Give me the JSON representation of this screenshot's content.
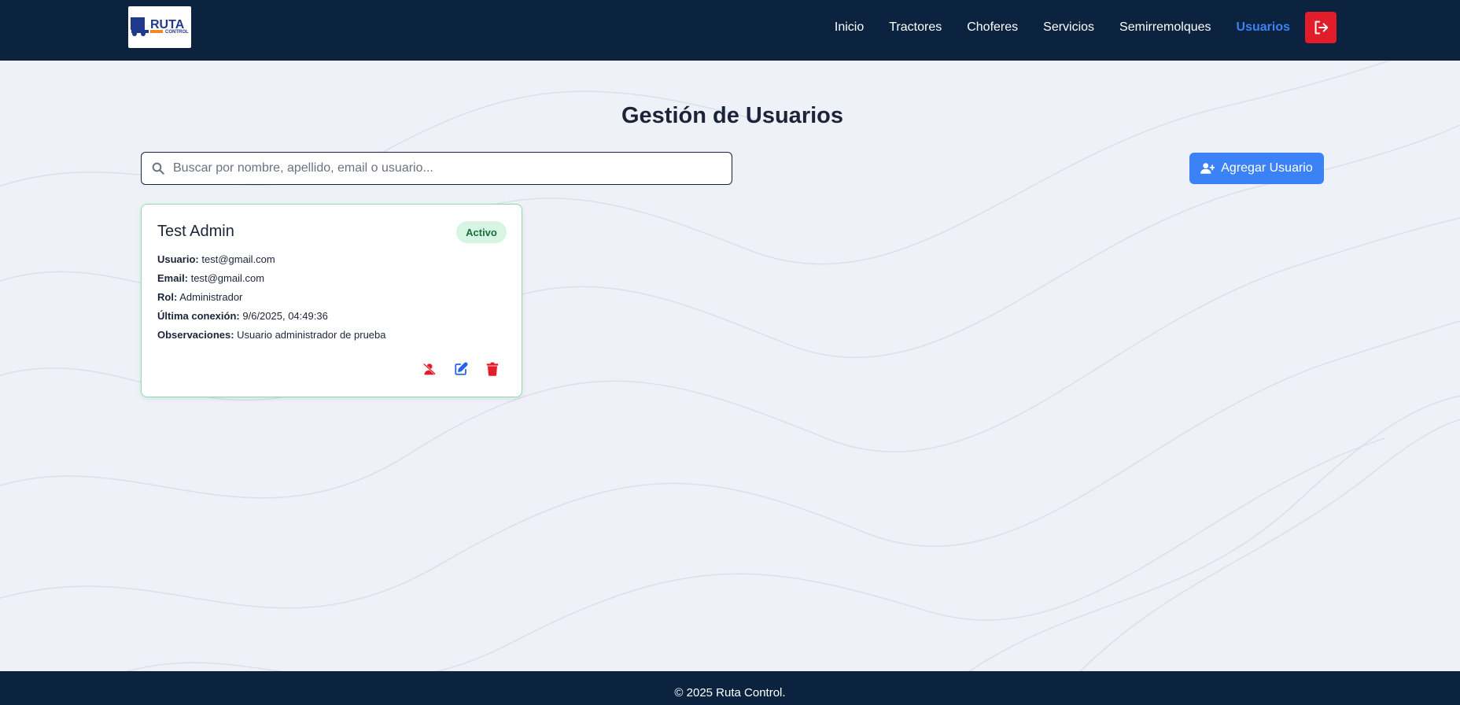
{
  "brand": {
    "logo_text": "RUTA",
    "logo_subtext": "CONTROL"
  },
  "nav": {
    "items": [
      {
        "label": "Inicio",
        "active": false
      },
      {
        "label": "Tractores",
        "active": false
      },
      {
        "label": "Choferes",
        "active": false
      },
      {
        "label": "Servicios",
        "active": false
      },
      {
        "label": "Semirremolques",
        "active": false
      },
      {
        "label": "Usuarios",
        "active": true
      }
    ],
    "logout_icon": "logout-icon"
  },
  "page": {
    "title": "Gestión de Usuarios"
  },
  "search": {
    "placeholder": "Buscar por nombre, apellido, email o usuario...",
    "value": ""
  },
  "add_button": {
    "label": "Agregar Usuario",
    "icon": "user-plus-icon"
  },
  "users": [
    {
      "name": "Test Admin",
      "status": "Activo",
      "fields": [
        {
          "label": "Usuario:",
          "value": "test@gmail.com"
        },
        {
          "label": "Email:",
          "value": "test@gmail.com"
        },
        {
          "label": "Rol:",
          "value": "Administrador"
        },
        {
          "label": "Última conexión:",
          "value": "9/6/2025, 04:49:36"
        },
        {
          "label": "Observaciones:",
          "value": "Usuario administrador de prueba"
        }
      ],
      "actions": [
        "user-slash-icon",
        "edit-icon",
        "trash-icon"
      ]
    }
  ],
  "footer": {
    "text": "© 2025 Ruta Control."
  },
  "colors": {
    "navbar": "#0c2340",
    "accent": "#3b82f6",
    "danger": "#e11d2a",
    "active_badge_bg": "#d8f5e3",
    "active_badge_text": "#16703e"
  }
}
